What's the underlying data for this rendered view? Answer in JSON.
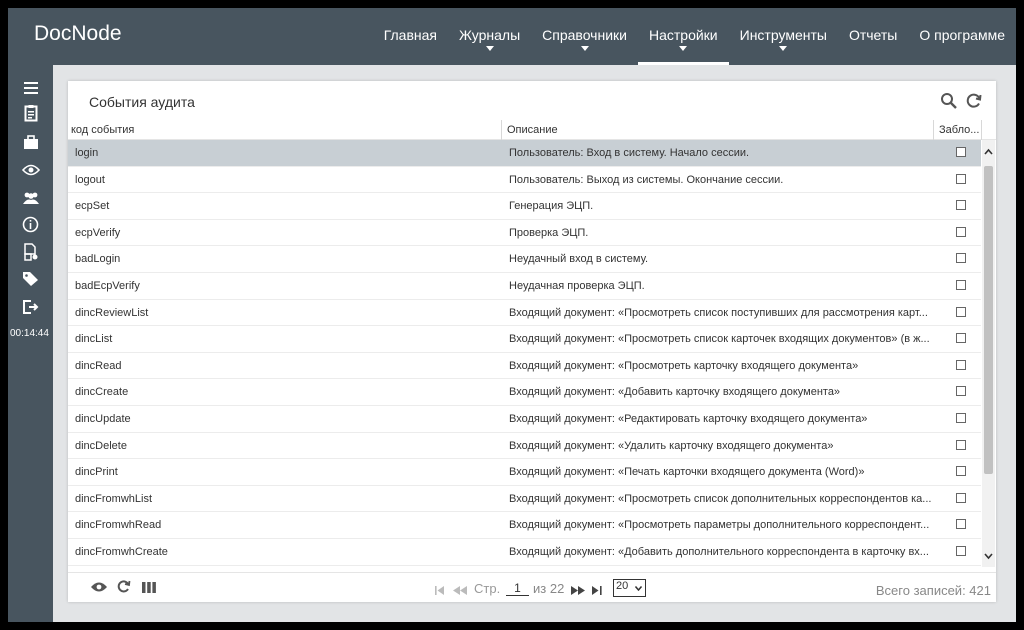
{
  "app": {
    "title": "DocNode"
  },
  "nav": [
    {
      "label": "Главная",
      "caret": false,
      "active": false
    },
    {
      "label": "Журналы",
      "caret": true,
      "active": false
    },
    {
      "label": "Справочники",
      "caret": true,
      "active": false
    },
    {
      "label": "Настройки",
      "caret": true,
      "active": true
    },
    {
      "label": "Инструменты",
      "caret": true,
      "active": false
    },
    {
      "label": "Отчеты",
      "caret": false,
      "active": false
    },
    {
      "label": "О программе",
      "caret": false,
      "active": false
    }
  ],
  "sidebar": {
    "icons": [
      "menu-icon",
      "clipboard-icon",
      "briefcase-icon",
      "eye-icon",
      "users-icon",
      "info-icon",
      "document-settings-icon",
      "tags-icon",
      "logout-icon"
    ],
    "timer": "00:14:44"
  },
  "panel": {
    "title": "События аудита",
    "tool_icons": [
      "search-icon",
      "refresh-icon"
    ]
  },
  "table": {
    "columns": [
      "код события",
      "Описание",
      "Забло..."
    ],
    "rows": [
      {
        "code": "login",
        "description": "Пользователь: Вход в систему. Начало сессии.",
        "selected": true
      },
      {
        "code": "logout",
        "description": "Пользователь: Выход из системы. Окончание сессии."
      },
      {
        "code": "ecpSet",
        "description": "Генерация ЭЦП."
      },
      {
        "code": "ecpVerify",
        "description": "Проверка ЭЦП."
      },
      {
        "code": "badLogin",
        "description": "Неудачный вход в систему."
      },
      {
        "code": "badEcpVerify",
        "description": "Неудачная проверка ЭЦП."
      },
      {
        "code": "dincReviewList",
        "description": "Входящий документ: «Просмотреть список поступивших для рассмотрения карт..."
      },
      {
        "code": "dincList",
        "description": "Входящий документ: «Просмотреть список карточек входящих документов» (в ж..."
      },
      {
        "code": "dincRead",
        "description": "Входящий документ: «Просмотреть карточку входящего документа»"
      },
      {
        "code": "dincCreate",
        "description": "Входящий документ: «Добавить карточку входящего документа»"
      },
      {
        "code": "dincUpdate",
        "description": "Входящий документ: «Редактировать карточку входящего документа»"
      },
      {
        "code": "dincDelete",
        "description": "Входящий документ: «Удалить карточку входящего документа»"
      },
      {
        "code": "dincPrint",
        "description": "Входящий документ: «Печать карточки входящего документа (Word)»"
      },
      {
        "code": "dincFromwhList",
        "description": "Входящий документ: «Просмотреть список дополнительных корреспондентов ка..."
      },
      {
        "code": "dincFromwhRead",
        "description": "Входящий документ: «Просмотреть параметры дополнительного корреспондент..."
      },
      {
        "code": "dincFromwhCreate",
        "description": "Входящий документ: «Добавить дополнительного корреспондента в карточку вх..."
      }
    ]
  },
  "pager": {
    "page_label": "Стр.",
    "page_value": "1",
    "of_label": "из 22",
    "page_size": "20",
    "total_label": "Всего записей: 421"
  },
  "colors": {
    "header_bg": "#48555f",
    "selected_row": "#c8cfd4",
    "content_bg": "#e2e4e6"
  }
}
